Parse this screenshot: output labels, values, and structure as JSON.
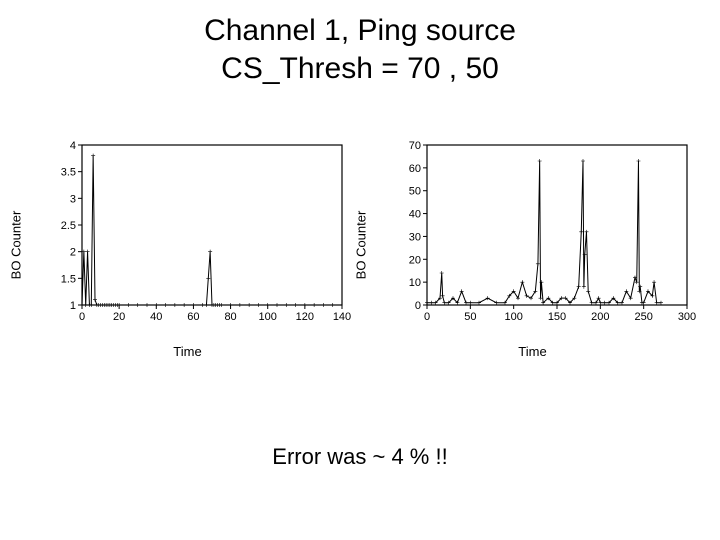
{
  "title": {
    "line1": "Channel 1, Ping source",
    "line2": "CS_Thresh = 70 , 50"
  },
  "note": "Error was ~ 4 % !!",
  "axis_labels": {
    "x": "Time",
    "y": "BO Counter"
  },
  "chart_data": [
    {
      "type": "line",
      "xlabel": "Time",
      "ylabel": "BO Counter",
      "xlim": [
        0,
        140
      ],
      "ylim": [
        1,
        4
      ],
      "xticks": [
        0,
        20,
        40,
        60,
        80,
        100,
        120,
        140
      ],
      "yticks": [
        1,
        1.5,
        2,
        2.5,
        3,
        3.5,
        4
      ],
      "x": [
        0,
        1,
        2,
        3,
        4,
        5,
        6,
        7,
        8,
        9,
        10,
        11,
        12,
        13,
        14,
        15,
        16,
        17,
        18,
        19,
        20,
        25,
        30,
        35,
        40,
        45,
        50,
        55,
        60,
        65,
        67,
        68,
        69,
        70,
        71,
        72,
        73,
        74,
        75,
        80,
        85,
        90,
        95,
        100,
        105,
        110,
        115,
        120,
        125,
        130,
        135
      ],
      "y": [
        1,
        2,
        1,
        2.0,
        1,
        1,
        3.8,
        1.1,
        1,
        1,
        1,
        1,
        1,
        1,
        1,
        1,
        1,
        1,
        1,
        1,
        1,
        1,
        1,
        1,
        1,
        1,
        1,
        1,
        1,
        1,
        1,
        1.5,
        2.0,
        1,
        1,
        1,
        1,
        1,
        1,
        1,
        1,
        1,
        1,
        1,
        1,
        1,
        1,
        1,
        1,
        1,
        1
      ]
    },
    {
      "type": "line",
      "xlabel": "Time",
      "ylabel": "BO Counter",
      "xlim": [
        0,
        300
      ],
      "ylim": [
        0,
        70
      ],
      "xticks": [
        0,
        50,
        100,
        150,
        200,
        250,
        300
      ],
      "yticks": [
        0,
        10,
        20,
        30,
        40,
        50,
        60,
        70
      ],
      "x": [
        0,
        5,
        10,
        15,
        17,
        18,
        20,
        25,
        30,
        35,
        40,
        45,
        50,
        60,
        70,
        80,
        90,
        95,
        100,
        105,
        110,
        115,
        120,
        125,
        128,
        130,
        131,
        132,
        134,
        140,
        145,
        150,
        155,
        160,
        165,
        170,
        175,
        178,
        180,
        181,
        182,
        184,
        186,
        190,
        195,
        198,
        200,
        205,
        210,
        215,
        220,
        225,
        230,
        235,
        240,
        242,
        244,
        245,
        246,
        248,
        250,
        255,
        260,
        262,
        265,
        270
      ],
      "y": [
        1,
        1,
        1,
        3,
        14,
        4,
        1,
        1,
        3,
        1,
        6,
        1,
        1,
        1,
        3,
        1,
        1,
        4,
        6,
        3,
        10,
        4,
        3,
        6,
        18,
        63,
        3,
        10,
        1,
        3,
        1,
        1,
        3,
        3,
        1,
        3,
        8,
        32,
        63,
        8,
        22,
        32,
        6,
        1,
        1,
        3,
        1,
        1,
        1,
        3,
        1,
        1,
        6,
        3,
        12,
        10,
        63,
        6,
        8,
        1,
        1,
        6,
        4,
        10,
        1,
        1
      ]
    }
  ]
}
